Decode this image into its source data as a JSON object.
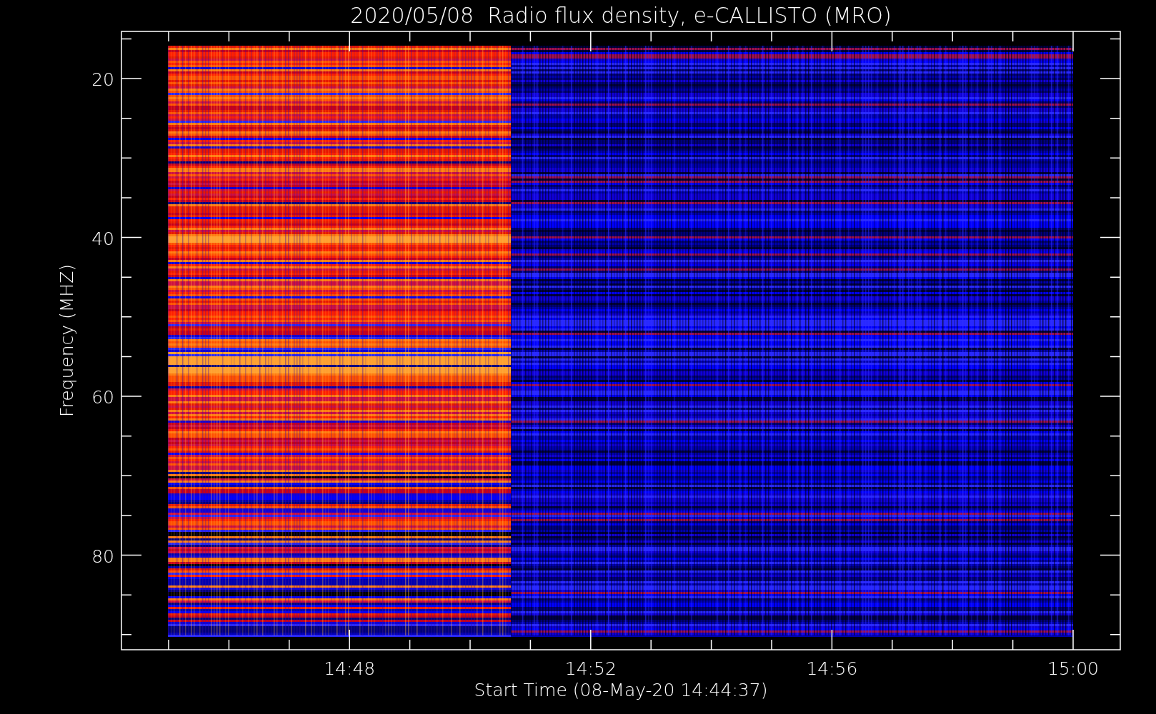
{
  "title": "2020/05/08  Radio flux density, e-CALLISTO (MRO)",
  "y_axis": {
    "title": "Frequency (MHZ)",
    "tick_labels": [
      "20",
      "40",
      "60",
      "80"
    ]
  },
  "x_axis": {
    "title": "Start Time (08-May-20 14:44:37)",
    "tick_labels": [
      "14:48",
      "14:52",
      "14:56",
      "15:00"
    ]
  }
}
